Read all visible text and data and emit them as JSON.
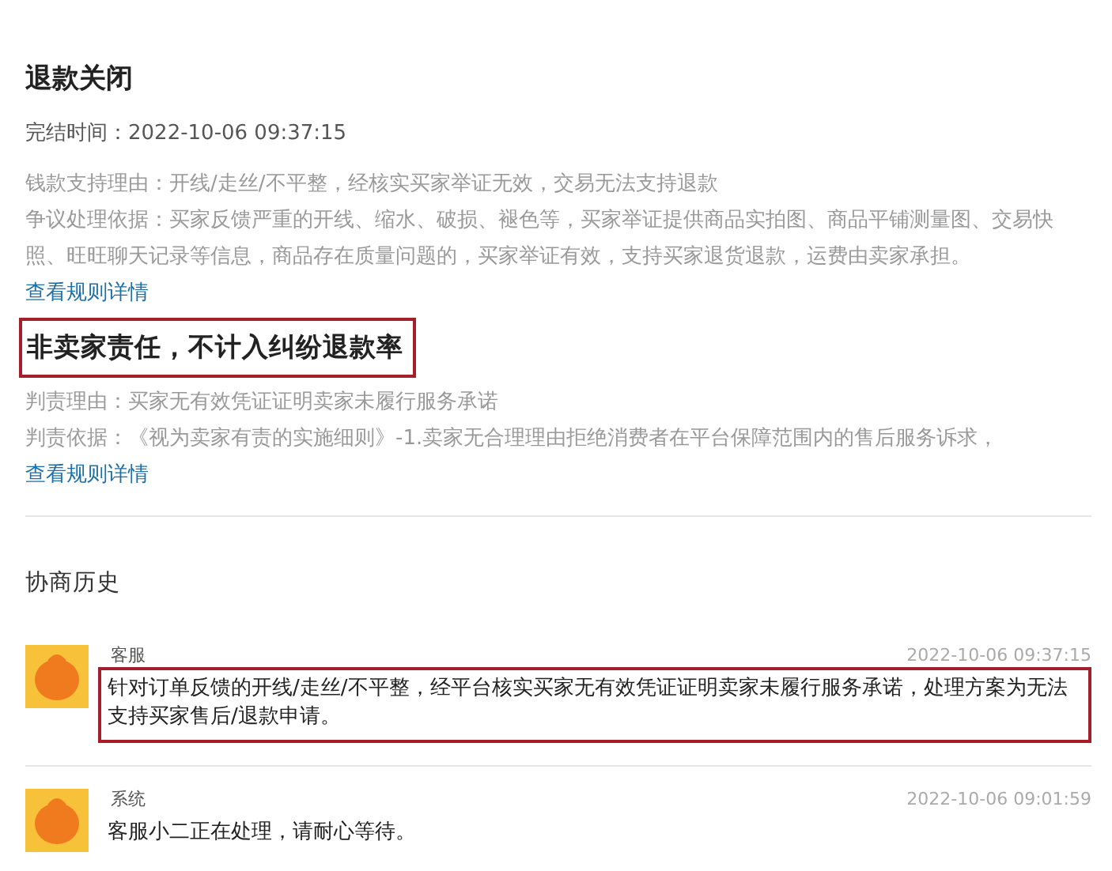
{
  "status": {
    "title": "退款关闭",
    "finish_label": "完结时间：",
    "finish_time": "2022-10-06 09:37:15"
  },
  "reasons": [
    {
      "text": "钱款支持理由：开线/走丝/不平整，经核实买家举证无效，交易无法支持退款"
    },
    {
      "text": "争议处理依据：买家反馈严重的开线、缩水、破损、褪色等，买家举证提供商品实拍图、商品平铺测量图、交易快照、旺旺聊天记录等信息，商品存在质量问题的，买家举证有效，支持买家退货退款，运费由卖家承担。",
      "link": "查看规则详情"
    }
  ],
  "verdict": {
    "title": "非卖家责任，不计入纠纷退款率",
    "highlighted": true
  },
  "verdict_reasons": [
    {
      "text": "判责理由：买家无有效凭证证明卖家未履行服务承诺"
    },
    {
      "text": "判责依据：《视为卖家有责的实施细则》-1.卖家无合理理由拒绝消费者在平台保障范围内的售后服务诉求，",
      "link": "查看规则详情"
    }
  ],
  "history": {
    "title": "协商历史",
    "messages": [
      {
        "sender": "客服",
        "time": "2022-10-06 09:37:15",
        "text": "针对订单反馈的开线/走丝/不平整，经平台核实买家无有效凭证证明卖家未履行服务承诺，处理方案为无法支持买家售后/退款申请。",
        "highlighted": true
      },
      {
        "sender": "系统",
        "time": "2022-10-06 09:01:59",
        "text": "客服小二正在处理，请耐心等待。",
        "highlighted": false
      }
    ]
  }
}
